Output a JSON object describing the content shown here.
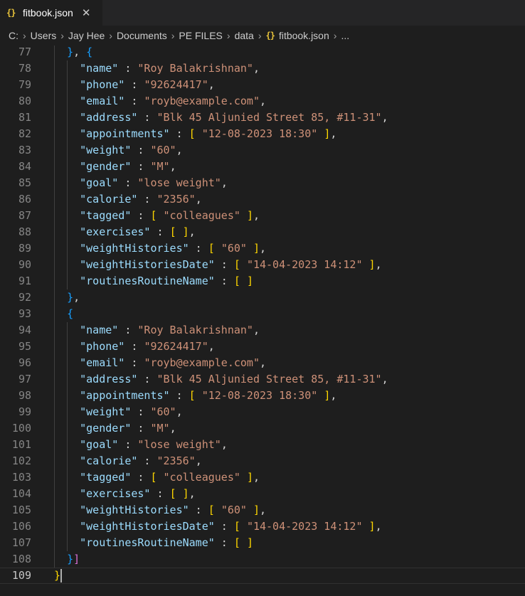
{
  "tab": {
    "icon": "json-icon",
    "label": "fitbook.json",
    "close": "✕"
  },
  "breadcrumb": {
    "parts": [
      "C:",
      "Users",
      "Jay Hee",
      "Documents",
      "PE FILES",
      "data"
    ],
    "file": "fitbook.json",
    "ellipsis": "...",
    "separator": "›"
  },
  "editor": {
    "first_line": 77,
    "active_line": 109,
    "lines": [
      [
        {
          "t": "  ",
          "c": "p"
        },
        {
          "t": "}",
          "c": "b3"
        },
        {
          "t": ", ",
          "c": "p"
        },
        {
          "t": "{",
          "c": "b3"
        }
      ],
      [
        {
          "t": "    ",
          "c": "p"
        },
        {
          "t": "\"name\"",
          "c": "k"
        },
        {
          "t": " : ",
          "c": "p"
        },
        {
          "t": "\"Roy Balakrishnan\"",
          "c": "s"
        },
        {
          "t": ",",
          "c": "p"
        }
      ],
      [
        {
          "t": "    ",
          "c": "p"
        },
        {
          "t": "\"phone\"",
          "c": "k"
        },
        {
          "t": " : ",
          "c": "p"
        },
        {
          "t": "\"92624417\"",
          "c": "s"
        },
        {
          "t": ",",
          "c": "p"
        }
      ],
      [
        {
          "t": "    ",
          "c": "p"
        },
        {
          "t": "\"email\"",
          "c": "k"
        },
        {
          "t": " : ",
          "c": "p"
        },
        {
          "t": "\"royb@example.com\"",
          "c": "s"
        },
        {
          "t": ",",
          "c": "p"
        }
      ],
      [
        {
          "t": "    ",
          "c": "p"
        },
        {
          "t": "\"address\"",
          "c": "k"
        },
        {
          "t": " : ",
          "c": "p"
        },
        {
          "t": "\"Blk 45 Aljunied Street 85, #11-31\"",
          "c": "s"
        },
        {
          "t": ",",
          "c": "p"
        }
      ],
      [
        {
          "t": "    ",
          "c": "p"
        },
        {
          "t": "\"appointments\"",
          "c": "k"
        },
        {
          "t": " : ",
          "c": "p"
        },
        {
          "t": "[",
          "c": "b1"
        },
        {
          "t": " ",
          "c": "p"
        },
        {
          "t": "\"12-08-2023 18:30\"",
          "c": "s"
        },
        {
          "t": " ",
          "c": "p"
        },
        {
          "t": "]",
          "c": "b1"
        },
        {
          "t": ",",
          "c": "p"
        }
      ],
      [
        {
          "t": "    ",
          "c": "p"
        },
        {
          "t": "\"weight\"",
          "c": "k"
        },
        {
          "t": " : ",
          "c": "p"
        },
        {
          "t": "\"60\"",
          "c": "s"
        },
        {
          "t": ",",
          "c": "p"
        }
      ],
      [
        {
          "t": "    ",
          "c": "p"
        },
        {
          "t": "\"gender\"",
          "c": "k"
        },
        {
          "t": " : ",
          "c": "p"
        },
        {
          "t": "\"M\"",
          "c": "s"
        },
        {
          "t": ",",
          "c": "p"
        }
      ],
      [
        {
          "t": "    ",
          "c": "p"
        },
        {
          "t": "\"goal\"",
          "c": "k"
        },
        {
          "t": " : ",
          "c": "p"
        },
        {
          "t": "\"lose weight\"",
          "c": "s"
        },
        {
          "t": ",",
          "c": "p"
        }
      ],
      [
        {
          "t": "    ",
          "c": "p"
        },
        {
          "t": "\"calorie\"",
          "c": "k"
        },
        {
          "t": " : ",
          "c": "p"
        },
        {
          "t": "\"2356\"",
          "c": "s"
        },
        {
          "t": ",",
          "c": "p"
        }
      ],
      [
        {
          "t": "    ",
          "c": "p"
        },
        {
          "t": "\"tagged\"",
          "c": "k"
        },
        {
          "t": " : ",
          "c": "p"
        },
        {
          "t": "[",
          "c": "b1"
        },
        {
          "t": " ",
          "c": "p"
        },
        {
          "t": "\"colleagues\"",
          "c": "s"
        },
        {
          "t": " ",
          "c": "p"
        },
        {
          "t": "]",
          "c": "b1"
        },
        {
          "t": ",",
          "c": "p"
        }
      ],
      [
        {
          "t": "    ",
          "c": "p"
        },
        {
          "t": "\"exercises\"",
          "c": "k"
        },
        {
          "t": " : ",
          "c": "p"
        },
        {
          "t": "[",
          "c": "b1"
        },
        {
          "t": " ",
          "c": "p"
        },
        {
          "t": "]",
          "c": "b1"
        },
        {
          "t": ",",
          "c": "p"
        }
      ],
      [
        {
          "t": "    ",
          "c": "p"
        },
        {
          "t": "\"weightHistories\"",
          "c": "k"
        },
        {
          "t": " : ",
          "c": "p"
        },
        {
          "t": "[",
          "c": "b1"
        },
        {
          "t": " ",
          "c": "p"
        },
        {
          "t": "\"60\"",
          "c": "s"
        },
        {
          "t": " ",
          "c": "p"
        },
        {
          "t": "]",
          "c": "b1"
        },
        {
          "t": ",",
          "c": "p"
        }
      ],
      [
        {
          "t": "    ",
          "c": "p"
        },
        {
          "t": "\"weightHistoriesDate\"",
          "c": "k"
        },
        {
          "t": " : ",
          "c": "p"
        },
        {
          "t": "[",
          "c": "b1"
        },
        {
          "t": " ",
          "c": "p"
        },
        {
          "t": "\"14-04-2023 14:12\"",
          "c": "s"
        },
        {
          "t": " ",
          "c": "p"
        },
        {
          "t": "]",
          "c": "b1"
        },
        {
          "t": ",",
          "c": "p"
        }
      ],
      [
        {
          "t": "    ",
          "c": "p"
        },
        {
          "t": "\"routinesRoutineName\"",
          "c": "k"
        },
        {
          "t": " : ",
          "c": "p"
        },
        {
          "t": "[",
          "c": "b1"
        },
        {
          "t": " ",
          "c": "p"
        },
        {
          "t": "]",
          "c": "b1"
        }
      ],
      [
        {
          "t": "  ",
          "c": "p"
        },
        {
          "t": "}",
          "c": "b3"
        },
        {
          "t": ",",
          "c": "p"
        }
      ],
      [
        {
          "t": "  ",
          "c": "p"
        },
        {
          "t": "{",
          "c": "b3"
        }
      ],
      [
        {
          "t": "    ",
          "c": "p"
        },
        {
          "t": "\"name\"",
          "c": "k"
        },
        {
          "t": " : ",
          "c": "p"
        },
        {
          "t": "\"Roy Balakrishnan\"",
          "c": "s"
        },
        {
          "t": ",",
          "c": "p"
        }
      ],
      [
        {
          "t": "    ",
          "c": "p"
        },
        {
          "t": "\"phone\"",
          "c": "k"
        },
        {
          "t": " : ",
          "c": "p"
        },
        {
          "t": "\"92624417\"",
          "c": "s"
        },
        {
          "t": ",",
          "c": "p"
        }
      ],
      [
        {
          "t": "    ",
          "c": "p"
        },
        {
          "t": "\"email\"",
          "c": "k"
        },
        {
          "t": " : ",
          "c": "p"
        },
        {
          "t": "\"royb@example.com\"",
          "c": "s"
        },
        {
          "t": ",",
          "c": "p"
        }
      ],
      [
        {
          "t": "    ",
          "c": "p"
        },
        {
          "t": "\"address\"",
          "c": "k"
        },
        {
          "t": " : ",
          "c": "p"
        },
        {
          "t": "\"Blk 45 Aljunied Street 85, #11-31\"",
          "c": "s"
        },
        {
          "t": ",",
          "c": "p"
        }
      ],
      [
        {
          "t": "    ",
          "c": "p"
        },
        {
          "t": "\"appointments\"",
          "c": "k"
        },
        {
          "t": " : ",
          "c": "p"
        },
        {
          "t": "[",
          "c": "b1"
        },
        {
          "t": " ",
          "c": "p"
        },
        {
          "t": "\"12-08-2023 18:30\"",
          "c": "s"
        },
        {
          "t": " ",
          "c": "p"
        },
        {
          "t": "]",
          "c": "b1"
        },
        {
          "t": ",",
          "c": "p"
        }
      ],
      [
        {
          "t": "    ",
          "c": "p"
        },
        {
          "t": "\"weight\"",
          "c": "k"
        },
        {
          "t": " : ",
          "c": "p"
        },
        {
          "t": "\"60\"",
          "c": "s"
        },
        {
          "t": ",",
          "c": "p"
        }
      ],
      [
        {
          "t": "    ",
          "c": "p"
        },
        {
          "t": "\"gender\"",
          "c": "k"
        },
        {
          "t": " : ",
          "c": "p"
        },
        {
          "t": "\"M\"",
          "c": "s"
        },
        {
          "t": ",",
          "c": "p"
        }
      ],
      [
        {
          "t": "    ",
          "c": "p"
        },
        {
          "t": "\"goal\"",
          "c": "k"
        },
        {
          "t": " : ",
          "c": "p"
        },
        {
          "t": "\"lose weight\"",
          "c": "s"
        },
        {
          "t": ",",
          "c": "p"
        }
      ],
      [
        {
          "t": "    ",
          "c": "p"
        },
        {
          "t": "\"calorie\"",
          "c": "k"
        },
        {
          "t": " : ",
          "c": "p"
        },
        {
          "t": "\"2356\"",
          "c": "s"
        },
        {
          "t": ",",
          "c": "p"
        }
      ],
      [
        {
          "t": "    ",
          "c": "p"
        },
        {
          "t": "\"tagged\"",
          "c": "k"
        },
        {
          "t": " : ",
          "c": "p"
        },
        {
          "t": "[",
          "c": "b1"
        },
        {
          "t": " ",
          "c": "p"
        },
        {
          "t": "\"colleagues\"",
          "c": "s"
        },
        {
          "t": " ",
          "c": "p"
        },
        {
          "t": "]",
          "c": "b1"
        },
        {
          "t": ",",
          "c": "p"
        }
      ],
      [
        {
          "t": "    ",
          "c": "p"
        },
        {
          "t": "\"exercises\"",
          "c": "k"
        },
        {
          "t": " : ",
          "c": "p"
        },
        {
          "t": "[",
          "c": "b1"
        },
        {
          "t": " ",
          "c": "p"
        },
        {
          "t": "]",
          "c": "b1"
        },
        {
          "t": ",",
          "c": "p"
        }
      ],
      [
        {
          "t": "    ",
          "c": "p"
        },
        {
          "t": "\"weightHistories\"",
          "c": "k"
        },
        {
          "t": " : ",
          "c": "p"
        },
        {
          "t": "[",
          "c": "b1"
        },
        {
          "t": " ",
          "c": "p"
        },
        {
          "t": "\"60\"",
          "c": "s"
        },
        {
          "t": " ",
          "c": "p"
        },
        {
          "t": "]",
          "c": "b1"
        },
        {
          "t": ",",
          "c": "p"
        }
      ],
      [
        {
          "t": "    ",
          "c": "p"
        },
        {
          "t": "\"weightHistoriesDate\"",
          "c": "k"
        },
        {
          "t": " : ",
          "c": "p"
        },
        {
          "t": "[",
          "c": "b1"
        },
        {
          "t": " ",
          "c": "p"
        },
        {
          "t": "\"14-04-2023 14:12\"",
          "c": "s"
        },
        {
          "t": " ",
          "c": "p"
        },
        {
          "t": "]",
          "c": "b1"
        },
        {
          "t": ",",
          "c": "p"
        }
      ],
      [
        {
          "t": "    ",
          "c": "p"
        },
        {
          "t": "\"routinesRoutineName\"",
          "c": "k"
        },
        {
          "t": " : ",
          "c": "p"
        },
        {
          "t": "[",
          "c": "b1"
        },
        {
          "t": " ",
          "c": "p"
        },
        {
          "t": "]",
          "c": "b1"
        }
      ],
      [
        {
          "t": "  ",
          "c": "p"
        },
        {
          "t": "}",
          "c": "b3"
        },
        {
          "t": "]",
          "c": "b2"
        }
      ],
      [
        {
          "t": "}",
          "c": "b1"
        }
      ]
    ]
  },
  "colors": {
    "background": "#1e1e1e",
    "tab_bar": "#252526",
    "key": "#9cdcfe",
    "string": "#ce9178",
    "bracket_level_1": "#ffd700",
    "bracket_level_2": "#da70d6",
    "bracket_level_3": "#179fff",
    "json_icon": "#e8c33a"
  }
}
